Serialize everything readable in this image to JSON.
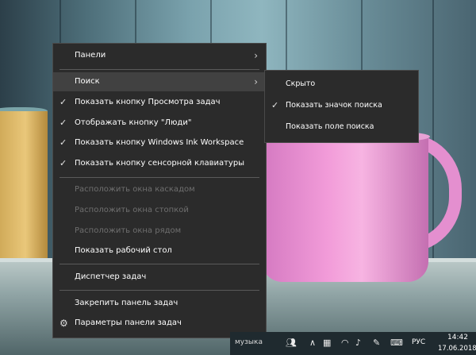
{
  "menu": {
    "items": [
      {
        "label": "Панели",
        "checked": false,
        "disabled": false,
        "submenu": true
      },
      {
        "label": "Поиск",
        "checked": false,
        "disabled": false,
        "submenu": true,
        "highlighted": true
      },
      {
        "label": "Показать кнопку Просмотра задач",
        "checked": true,
        "disabled": false
      },
      {
        "label": "Отображать кнопку \"Люди\"",
        "checked": true,
        "disabled": false
      },
      {
        "label": "Показать кнопку Windows Ink Workspace",
        "checked": true,
        "disabled": false
      },
      {
        "label": "Показать кнопку сенсорной клавиатуры",
        "checked": true,
        "disabled": false
      },
      {
        "label": "Расположить окна каскадом",
        "checked": false,
        "disabled": true
      },
      {
        "label": "Расположить окна стопкой",
        "checked": false,
        "disabled": true
      },
      {
        "label": "Расположить окна рядом",
        "checked": false,
        "disabled": true
      },
      {
        "label": "Показать рабочий стол",
        "checked": false,
        "disabled": false
      },
      {
        "label": "Диспетчер задач",
        "checked": false,
        "disabled": false
      },
      {
        "label": "Закрепить панель задач",
        "checked": false,
        "disabled": false
      },
      {
        "label": "Параметры панели задач",
        "checked": false,
        "disabled": false,
        "icon": "gear-icon"
      }
    ]
  },
  "submenu": {
    "items": [
      {
        "label": "Скрыто",
        "checked": false
      },
      {
        "label": "Показать значок поиска",
        "checked": true
      },
      {
        "label": "Показать поле поиска",
        "checked": false
      }
    ]
  },
  "taskbar": {
    "search_label": "музыка",
    "language": "РУС",
    "time": "14:42",
    "date": "17.06.2018",
    "icons": [
      "people-icon",
      "chevron-up-icon",
      "network-icon",
      "wifi-icon",
      "volume-icon",
      "pen-icon",
      "keyboard-icon",
      "notification-icon"
    ]
  },
  "colors": {
    "menu_bg": "#2b2b2b",
    "menu_hover": "#414141",
    "disabled_text": "#6f6f6f",
    "taskbar_bg": "#1f2a2f"
  }
}
